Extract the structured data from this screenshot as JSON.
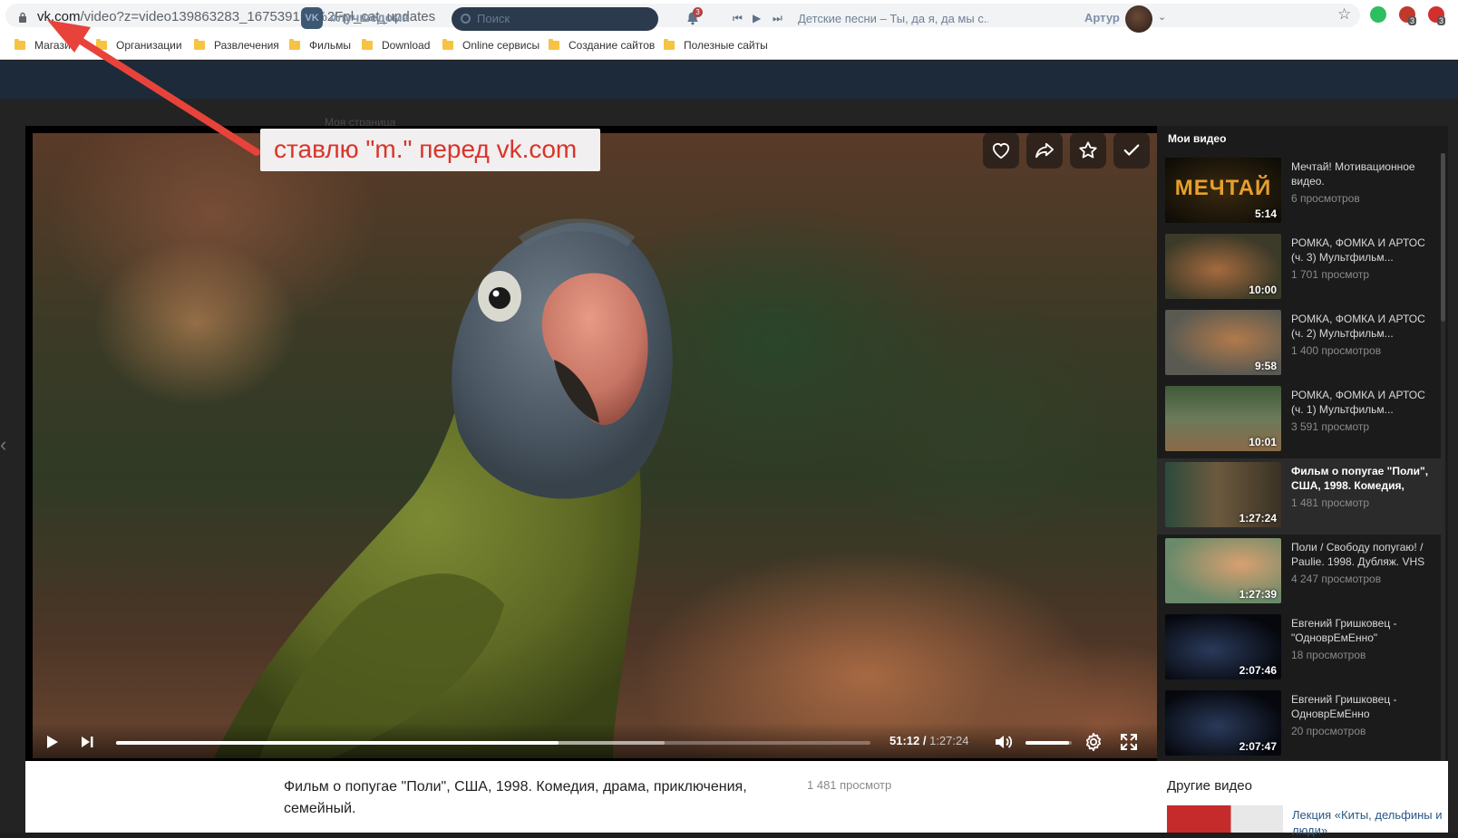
{
  "browser": {
    "url_host": "vk.com",
    "url_path": "/video?z=video139863283_167539154%2Fpl_cat_updates",
    "extension_badges": [
      "3",
      "3"
    ],
    "bookmarks": [
      "Магазин",
      "Организации",
      "Развлечения",
      "Фильмы",
      "Download",
      "Online сервисы",
      "Создание сайтов",
      "Полезные сайты"
    ]
  },
  "vk_header": {
    "logo": "VK",
    "hashtag": "#лучшедома",
    "search_placeholder": "Поиск",
    "notifications_count": "3",
    "track": "Детские песни – Ты, да я, да мы с...",
    "user_name": "Артур"
  },
  "background_page": {
    "my_page": "Моя страница"
  },
  "annotation": {
    "text": "ставлю \"m.\" перед vk.com"
  },
  "player": {
    "current_time": "51:12",
    "duration": "1:27:24",
    "progress_fraction": 0.586,
    "buffered_fraction": 0.727,
    "volume_fraction": 0.95
  },
  "sidebar": {
    "title": "Мои видео",
    "videos": [
      {
        "title": "Мечтай! Мотивационное видео.",
        "views": "6 просмотров",
        "duration": "5:14",
        "thumb_text": "МЕЧТАЙ",
        "active": false
      },
      {
        "title": "РОМКА, ФОМКА И АРТОС (ч. 3) Мультфильм...",
        "views": "1 701 просмотр",
        "duration": "10:00",
        "active": false
      },
      {
        "title": "РОМКА, ФОМКА И АРТОС (ч. 2) Мультфильм...",
        "views": "1 400 просмотров",
        "duration": "9:58",
        "active": false
      },
      {
        "title": "РОМКА, ФОМКА И АРТОС (ч. 1) Мультфильм...",
        "views": "3 591 просмотр",
        "duration": "10:01",
        "active": false
      },
      {
        "title": "Фильм о попугае \"Поли\", США, 1998. Комедия, драм...",
        "views": "1 481 просмотр",
        "duration": "1:27:24",
        "active": true
      },
      {
        "title": "Поли / Свободу попугаю! / Paulie. 1998. Дубляж. VHS",
        "views": "4 247 просмотров",
        "duration": "1:27:39",
        "active": false
      },
      {
        "title": "Евгений Гришковец - \"ОдноврЕмЕнно\"",
        "views": "18 просмотров",
        "duration": "2:07:46",
        "active": false
      },
      {
        "title": "Евгений Гришковец - ОдноврЕмЕнно",
        "views": "20 просмотров",
        "duration": "2:07:47",
        "active": false
      }
    ]
  },
  "video_info": {
    "title": "Фильм о попугае \"Поли\", США, 1998. Комедия, драма, приключения, семейный.",
    "views": "1 481 просмотр"
  },
  "other_videos": {
    "title": "Другие видео",
    "first_link": "Лекция «Киты, дельфины и люди»"
  }
}
